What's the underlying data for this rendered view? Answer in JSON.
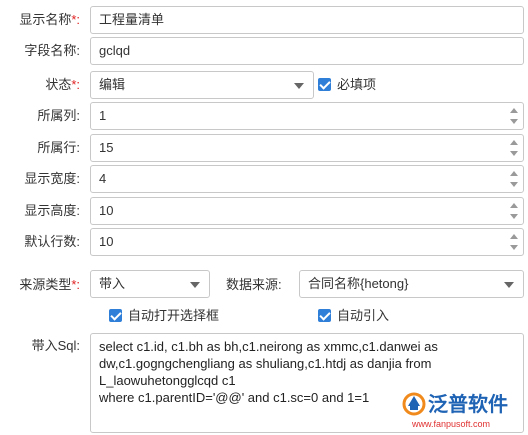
{
  "form": {
    "display_name": {
      "label": "显示名称",
      "required_mark": "*:",
      "value": "工程量清单"
    },
    "field_name": {
      "label": "字段名称:",
      "value": "gclqd"
    },
    "status": {
      "label": "状态",
      "required_mark": "*:",
      "value": "编辑"
    },
    "required_checkbox": {
      "label": "必填项",
      "checked": true
    },
    "column": {
      "label": "所属列:",
      "value": "1"
    },
    "row": {
      "label": "所属行:",
      "value": "15"
    },
    "display_width": {
      "label": "显示宽度:",
      "value": "4"
    },
    "display_height": {
      "label": "显示高度:",
      "value": "10"
    },
    "default_rows": {
      "label": "默认行数:",
      "value": "10"
    },
    "source_type": {
      "label": "来源类型",
      "required_mark": "*:",
      "value": "带入"
    },
    "data_source": {
      "label": "数据来源:",
      "value": "合同名称{hetong}"
    },
    "auto_open_checkbox": {
      "label": "自动打开选择框",
      "checked": true
    },
    "auto_import_checkbox": {
      "label": "自动引入",
      "checked": true
    },
    "import_sql": {
      "label": "带入Sql:",
      "lines": [
        "select c1.id, c1.bh as bh,c1.neirong as xmmc,c1.danwei as",
        "dw,c1.gogngchengliang as shuliang,c1.htdj as danjia from",
        "L_laowuhetongglcqd c1",
        "where c1.parentID='@@' and c1.sc=0 and 1=1"
      ]
    }
  },
  "watermark": {
    "brand_cn": "泛普软件",
    "url": "www.fanpusoft.com"
  },
  "colors": {
    "accent": "#2f7fd8",
    "required": "#e02020",
    "brand_orange": "#f08a1c",
    "brand_blue": "#1f63b5"
  }
}
